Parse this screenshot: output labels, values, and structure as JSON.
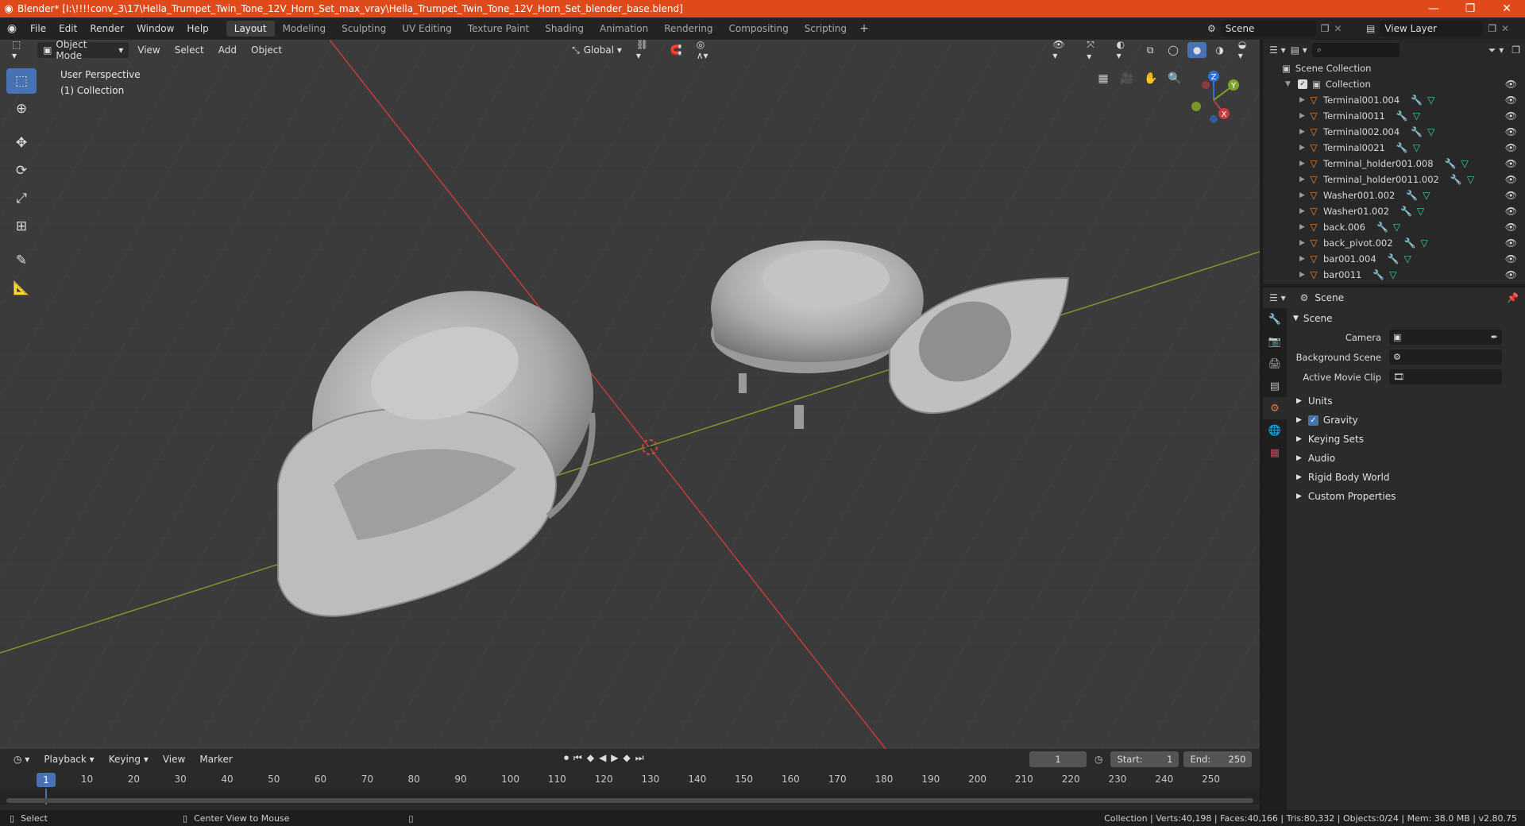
{
  "window": {
    "title": "Blender* [I:\\!!!!conv_3\\17\\Hella_Trumpet_Twin_Tone_12V_Horn_Set_max_vray\\Hella_Trumpet_Twin_Tone_12V_Horn_Set_blender_base.blend]",
    "minimize": "—",
    "restore": "❐",
    "close": "✕"
  },
  "menu": [
    "File",
    "Edit",
    "Render",
    "Window",
    "Help"
  ],
  "workspaces": [
    "Layout",
    "Modeling",
    "Sculpting",
    "UV Editing",
    "Texture Paint",
    "Shading",
    "Animation",
    "Rendering",
    "Compositing",
    "Scripting"
  ],
  "active_workspace": "Layout",
  "scene_name": "Scene",
  "view_layer": "View Layer",
  "viewport": {
    "mode": "Object Mode",
    "menus": [
      "View",
      "Select",
      "Add",
      "Object"
    ],
    "orientation": "Global",
    "info_line1": "User Perspective",
    "info_line2": "(1) Collection",
    "gizmo_x": "X",
    "gizmo_y": "Y",
    "gizmo_z": "Z"
  },
  "outliner": {
    "root": "Scene Collection",
    "collection": "Collection",
    "items": [
      "Terminal001.004",
      "Terminal0011",
      "Terminal002.004",
      "Terminal0021",
      "Terminal_holder001.008",
      "Terminal_holder0011.002",
      "Washer001.002",
      "Washer01.002",
      "back.006",
      "back_pivot.002",
      "bar001.004",
      "bar0011"
    ]
  },
  "properties": {
    "header": "Scene",
    "panel": "Scene",
    "camera_label": "Camera",
    "background_scene_label": "Background Scene",
    "active_movie_clip_label": "Active Movie Clip",
    "subpanels": [
      "Units",
      "Gravity",
      "Keying Sets",
      "Audio",
      "Rigid Body World",
      "Custom Properties"
    ],
    "gravity_checked": true
  },
  "timeline": {
    "menus": [
      "Playback",
      "Keying",
      "View",
      "Marker"
    ],
    "current_frame": "1",
    "start_label": "Start:",
    "start": "1",
    "end_label": "End:",
    "end": "250",
    "ticks": [
      "10",
      "20",
      "30",
      "40",
      "50",
      "60",
      "70",
      "80",
      "90",
      "100",
      "110",
      "120",
      "130",
      "140",
      "150",
      "160",
      "170",
      "180",
      "190",
      "200",
      "210",
      "220",
      "230",
      "240",
      "250"
    ],
    "cursor_frame": "1"
  },
  "status": {
    "left_action": "Select",
    "middle_action": "Center View to Mouse",
    "stats": "Collection | Verts:40,198 | Faces:40,166 | Tris:80,332 | Objects:0/24 | Mem: 38.0 MB | v2.80.75"
  },
  "colors": {
    "titlebar": "#e04a1a",
    "accent": "#4772b3",
    "viewport_bg": "#3b3b3b",
    "x_axis": "#c43c3c",
    "y_axis": "#7a9a2a",
    "object_icon": "#e8863a",
    "mesh_icon": "#3fcfa5"
  }
}
